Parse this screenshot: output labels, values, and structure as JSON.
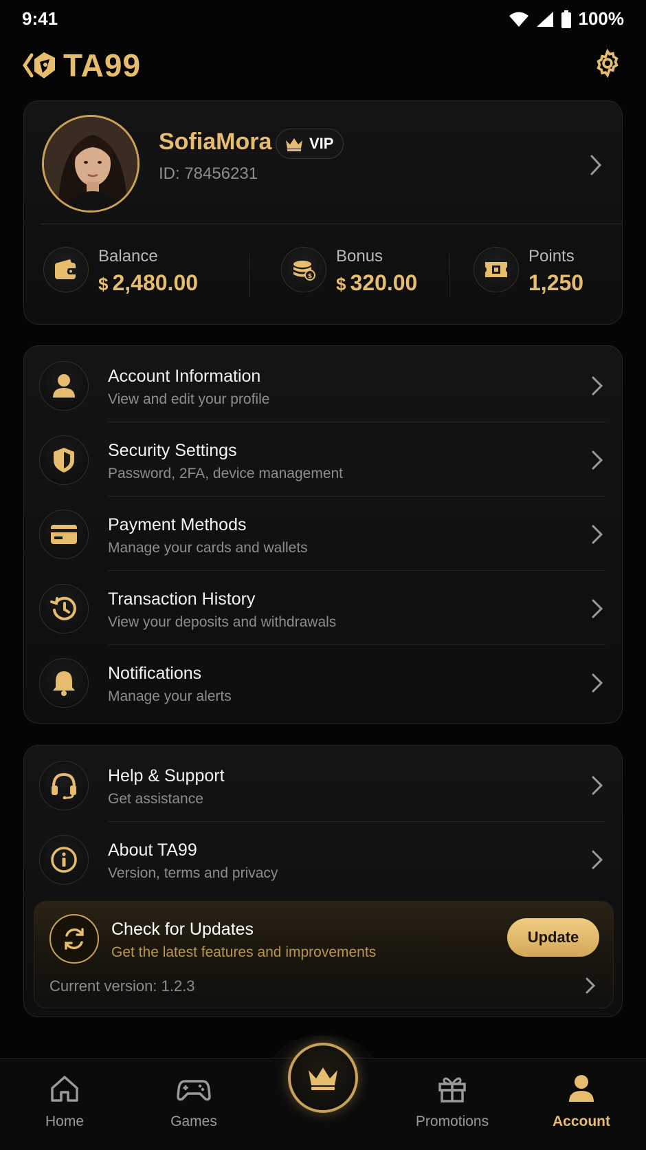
{
  "status_bar": {
    "time": "9:41",
    "battery": "100%"
  },
  "header": {
    "brand": "TA99",
    "icons": [
      "logo-mark-icon",
      "gear-icon"
    ]
  },
  "profile": {
    "name": "SofiaMora",
    "vip_label": "VIP",
    "id_text": "ID: 78456231",
    "stats": [
      {
        "label": "Balance",
        "currency": "$",
        "value": "2,480.00",
        "icon": "wallet-icon"
      },
      {
        "label": "Bonus",
        "currency": "$",
        "value": "320.00",
        "icon": "coins-icon"
      },
      {
        "label": "Points",
        "currency": "",
        "value": "1,250",
        "icon": "ticket-icon"
      }
    ]
  },
  "menu_main": [
    {
      "title": "Account Information",
      "subtitle": "View and edit your profile",
      "icon": "user-icon"
    },
    {
      "title": "Security Settings",
      "subtitle": "Password, 2FA, device management",
      "icon": "shield-icon"
    },
    {
      "title": "Payment Methods",
      "subtitle": "Manage your cards and wallets",
      "icon": "card-icon"
    },
    {
      "title": "Transaction History",
      "subtitle": "View your deposits and withdrawals",
      "icon": "history-icon"
    },
    {
      "title": "Notifications",
      "subtitle": "Manage your alerts",
      "icon": "bell-icon"
    }
  ],
  "menu_support": [
    {
      "title": "Help & Support",
      "subtitle": "Get assistance",
      "icon": "headset-icon"
    },
    {
      "title": "About TA99",
      "subtitle": "Version, terms and privacy",
      "icon": "info-icon"
    }
  ],
  "update": {
    "title": "Check for Updates",
    "subtitle": "Get the latest features and improvements",
    "button": "Update",
    "version": "Current version: 1.2.3"
  },
  "nav": [
    {
      "label": "Home",
      "icon": "home-icon",
      "active": false
    },
    {
      "label": "Games",
      "icon": "gamepad-icon",
      "active": false
    },
    {
      "label": "Promotions",
      "icon": "gift-icon",
      "active": false
    },
    {
      "label": "Account",
      "icon": "account-icon",
      "active": true
    }
  ],
  "colors": {
    "accent": "#e6bd6e",
    "background": "#050505",
    "card": "#121212"
  }
}
